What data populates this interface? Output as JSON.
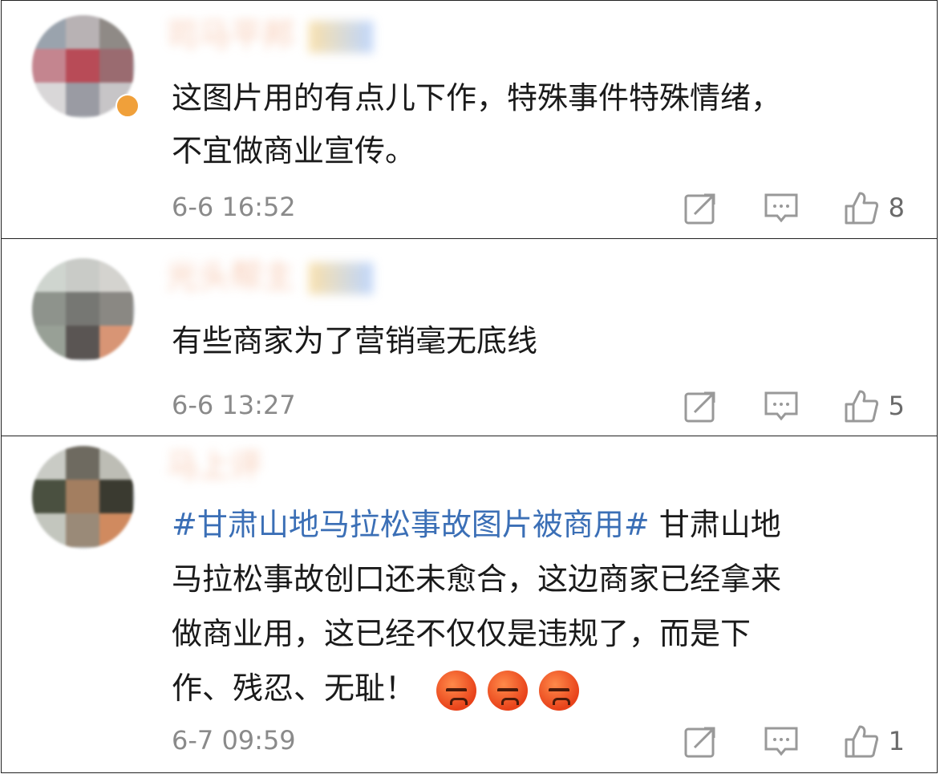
{
  "comments": [
    {
      "nickname": "司马平邦",
      "text_lines": [
        "这图片用的有点儿下作，特殊事件特殊情绪，",
        "不宜做商业宣传。"
      ],
      "time": "6-6 16:52",
      "likes": "8"
    },
    {
      "nickname": "光头帮主",
      "text_lines": [
        "有些商家为了营销毫无底线"
      ],
      "time": "6-6 13:27",
      "likes": "5"
    },
    {
      "nickname": "马上评",
      "topic": "#甘肃山地马拉松事故图片被商用#",
      "text_lines": [
        " 甘肃山地",
        "马拉松事故创口还未愈合，这边商家已经拿来",
        "做商业用，这已经不仅仅是违规了，而是下",
        "作、残忍、无耻！"
      ],
      "emoji_count": 3,
      "time": "6-7 09:59",
      "likes": "1"
    }
  ],
  "icons": {
    "share": "share-icon",
    "comment": "comment-icon",
    "like": "thumbs-up-icon",
    "emoji": "angry-face-icon"
  },
  "colors": {
    "topic": "#3b6fb6",
    "time": "#8a8a8a",
    "icon": "#999999"
  }
}
